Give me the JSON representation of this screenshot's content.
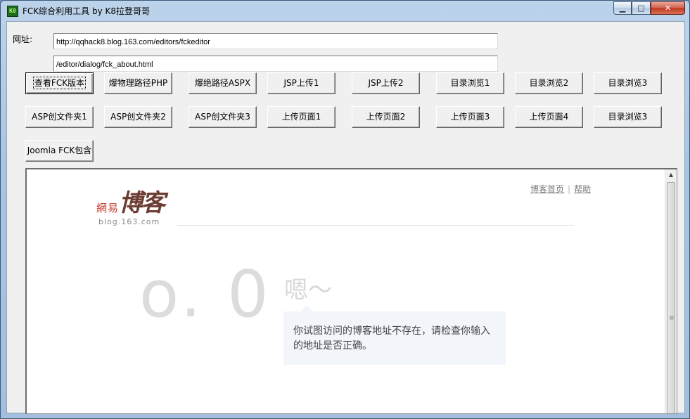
{
  "window": {
    "title": "FCK综合利用工具  by  K8拉登哥哥",
    "icon_text": "K8",
    "minimize_symbol": "▁",
    "maximize_symbol": "□",
    "close_symbol": "✕"
  },
  "form": {
    "url_label": "网址:",
    "url_value": "http://qqhack8.blog.163.com/editors/fckeditor",
    "path_value": "/editor/dialog/fck_about.html"
  },
  "buttons": {
    "row1": [
      "查看FCK版本",
      "爆物理路径PHP",
      "爆绝路径ASPX",
      "JSP上传1",
      "JSP上传2",
      "目录浏览1",
      "目录浏览2",
      "目录浏览3"
    ],
    "row2": [
      "ASP创文件夹1",
      "ASP创文件夹2",
      "ASP创文件夹3",
      "上传页面1",
      "上传页面2",
      "上传页面3",
      "上传页面4",
      "目录浏览3"
    ],
    "row3": [
      "Joomla FCK包含"
    ]
  },
  "browser": {
    "logo_wangyi": "網易",
    "logo_boke": "博客",
    "logo_domain": "blog.163.com",
    "link_home": "博客首页",
    "link_help": "帮助",
    "link_separator": "|",
    "big_face": "o. 0",
    "sigh": "嗯～",
    "message": "你试图访问的博客地址不存在，请检查你输入的地址是否正确。"
  },
  "colors": {
    "titlebar": "#bcd3ea",
    "close_button": "#c1341c",
    "logo_red": "#c63c2f",
    "logo_brown": "#6c3d33",
    "message_bg": "#f2f6fb"
  },
  "icons": {
    "app": "k8-app-icon",
    "scroll_up": "triangle-up-icon",
    "scroll_grip": "grip-lines-icon"
  }
}
